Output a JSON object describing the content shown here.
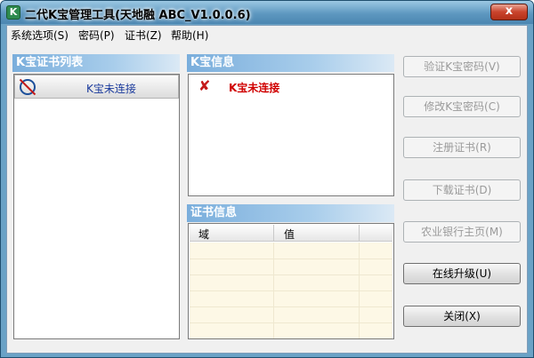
{
  "window": {
    "title": "二代K宝管理工具(天地融 ABC_V1.0.0.6)",
    "close_glyph": "x"
  },
  "menu": [
    "系统选项(S)",
    "密码(P)",
    "证书(Z)",
    "帮助(H)"
  ],
  "cert_list": {
    "header": "K宝证书列表",
    "item_label": "K宝未连接"
  },
  "kinfo": {
    "header": "K宝信息",
    "status": "K宝未连接"
  },
  "certinfo": {
    "header": "证书信息",
    "columns": [
      "域",
      "值"
    ]
  },
  "buttons": [
    {
      "label": "验证K宝密码(V)",
      "enabled": false
    },
    {
      "label": "修改K宝密码(C)",
      "enabled": false
    },
    {
      "label": "注册证书(R)",
      "enabled": false
    },
    {
      "label": "下载证书(D)",
      "enabled": false
    },
    {
      "label": "农业银行主页(M)",
      "enabled": false
    },
    {
      "label": "在线升级(U)",
      "enabled": true
    },
    {
      "label": "关闭(X)",
      "enabled": true
    }
  ]
}
